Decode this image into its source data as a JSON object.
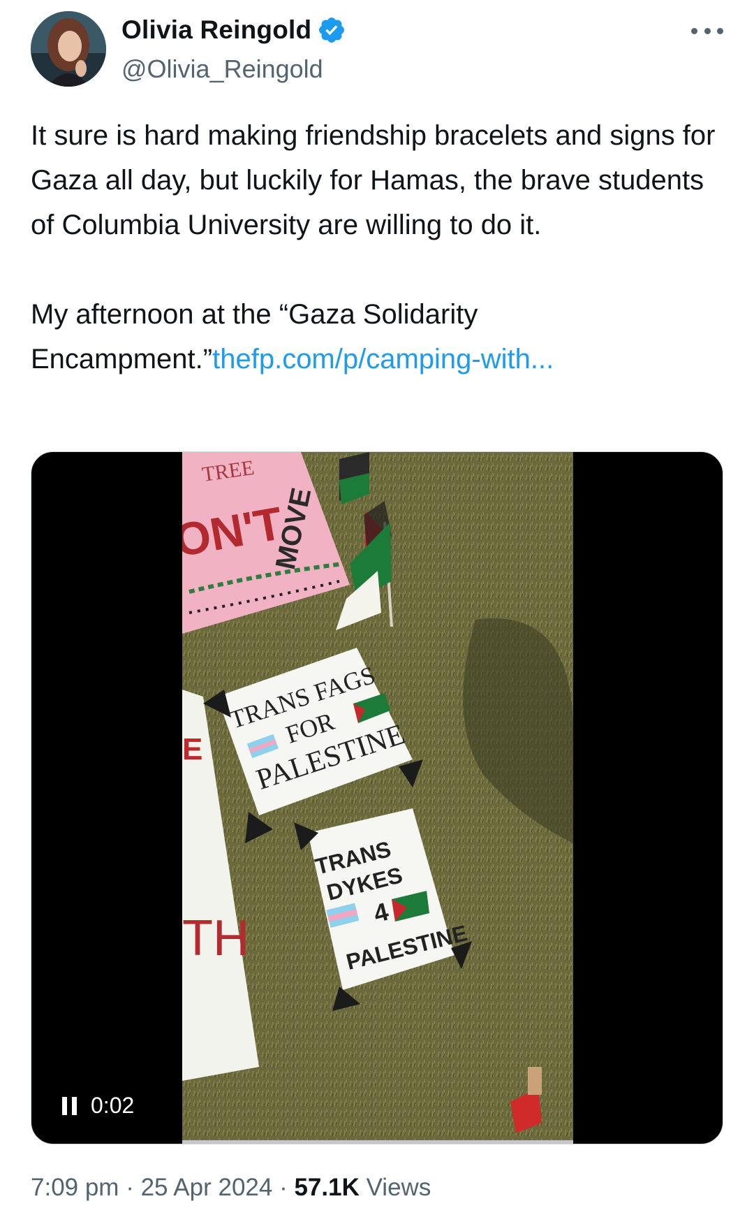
{
  "author": {
    "display_name": "Olivia Reingold",
    "handle": "@Olivia_Reingold",
    "verified": true,
    "accent_color": "#1d9bf0"
  },
  "tweet": {
    "paragraph1": "It sure is hard making friendship bracelets and signs for Gaza all day, but luckily for Hamas, the brave students of Columbia University are willing to do it.",
    "paragraph2_text": "My afternoon at the “Gaza Solidarity Encampment.”",
    "link_text": "thefp.com/p/camping-with..."
  },
  "video": {
    "time": "0:02",
    "state": "playing",
    "sign_top": [
      "TREE",
      "ON'T",
      "MOVE"
    ],
    "sign_middle": [
      "TRANS FAGS",
      "FOR",
      "PALESTINE"
    ],
    "sign_bottom": [
      "TRANS",
      "DYKES",
      "4",
      "PALESTINE"
    ],
    "sign_left": [
      "E",
      "TH"
    ]
  },
  "meta": {
    "time": "7:09 pm",
    "separator": " · ",
    "date": "25 Apr 2024",
    "views_count": "57.1K",
    "views_label": " Views"
  },
  "icons": {
    "verified": "verified-badge-icon",
    "more": "more-options-icon",
    "pause": "pause-icon"
  }
}
